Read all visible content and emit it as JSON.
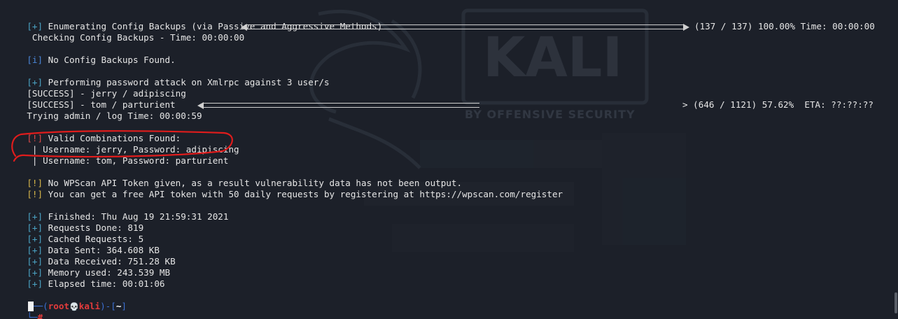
{
  "watermark": {
    "brand": "KALI",
    "tagline": "BY OFFENSIVE SECURITY"
  },
  "lines": {
    "l1_tag": "[+]",
    "l1_text": " Enumerating Config Backups (via Passive and Aggressive Methods)",
    "l2_text": " Checking Config Backups - Time: 00:00:00",
    "l2_right": "(137 / 137) 100.00% Time: 00:00:00",
    "l3_tag": "[i]",
    "l3_text": " No Config Backups Found.",
    "l4_tag": "[+]",
    "l4_text": " Performing password attack on Xmlrpc against 3 user/s",
    "l5_text": "[SUCCESS] - jerry / adipiscing",
    "l6_text": "[SUCCESS] - tom / parturient",
    "l7_text": "Trying admin / log Time: 00:00:59",
    "l7_right": "> (646 / 1121) 57.62%  ETA: ??:??:??",
    "l8_tag": "[!]",
    "l8_text": " Valid Combinations Found:",
    "l9_text": " | Username: jerry, Password: adipiscing",
    "l10_text": " | Username: tom, Password: parturient",
    "l11_tag": "[!]",
    "l11_text": " No WPScan API Token given, as a result vulnerability data has not been output.",
    "l12_tag": "[!]",
    "l12_text": " You can get a free API token with 50 daily requests by registering at https://wpscan.com/register",
    "l13_tag": "[+]",
    "l13_text": " Finished: Thu Aug 19 21:59:31 2021",
    "l14_tag": "[+]",
    "l14_text": " Requests Done: 819",
    "l15_tag": "[+]",
    "l15_text": " Cached Requests: 5",
    "l16_tag": "[+]",
    "l16_text": " Data Sent: 364.608 KB",
    "l17_tag": "[+]",
    "l17_text": " Data Received: 751.28 KB",
    "l18_tag": "[+]",
    "l18_text": " Memory used: 243.539 MB",
    "l19_tag": "[+]",
    "l19_text": " Elapsed time: 00:01:06"
  },
  "progress": {
    "config_backups_fraction": 1.0,
    "password_attack_fraction": 0.5762
  },
  "prompt": {
    "corner_top": "┌──(",
    "user": "root",
    "skull": "💀",
    "host": "kali",
    "mid": ")-[",
    "path": "~",
    "end": "]",
    "corner_bottom": "└─",
    "symbol": "#"
  },
  "colors": {
    "background": "#1c2029",
    "annotation": "#e01c1c",
    "tag_cyan": "#4aa3c4",
    "tag_yellow": "#d8b74a",
    "prompt_blue": "#3b6fd1",
    "prompt_red": "#e23b3b"
  }
}
